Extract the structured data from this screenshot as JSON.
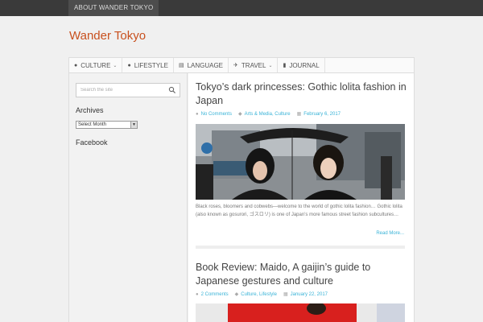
{
  "topbar": {
    "about_label": "ABOUT WANDER TOKYO"
  },
  "site": {
    "title": "Wander Tokyo"
  },
  "nav": {
    "items": [
      {
        "label": "CULTURE",
        "icon": "globe-icon",
        "has_dropdown": true
      },
      {
        "label": "LIFESTYLE",
        "icon": "info-icon",
        "has_dropdown": false
      },
      {
        "label": "LANGUAGE",
        "icon": "language-icon",
        "has_dropdown": false
      },
      {
        "label": "TRAVEL",
        "icon": "plane-icon",
        "has_dropdown": true
      },
      {
        "label": "JOURNAL",
        "icon": "book-icon",
        "has_dropdown": false
      }
    ]
  },
  "sidebar": {
    "search_placeholder": "Search the site",
    "archives_title": "Archives",
    "archives_select": "Select Month",
    "facebook_title": "Facebook"
  },
  "posts": [
    {
      "title": "Tokyo’s dark princesses: Gothic lolita fashion in Japan",
      "comments": "No Comments",
      "categories": "Arts & Media, Culture",
      "date": "February 6, 2017",
      "excerpt": "Black roses, bloomers and cobwebs—welcome to the world of gothic lolita fashion… Gothic lolita (also known as gosurori, ゴスロリ) is one of Japan’s more famous street fashion subcultures…",
      "read_more": "Read More..."
    },
    {
      "title": "Book Review: Maido, A gaijin’s guide to Japanese gestures and culture",
      "comments": "2 Comments",
      "categories": "Culture, Lifestyle",
      "date": "January 22, 2017"
    }
  ],
  "colors": {
    "accent": "#c8501e",
    "link": "#39b3d7",
    "topbar": "#3a3a3a"
  }
}
